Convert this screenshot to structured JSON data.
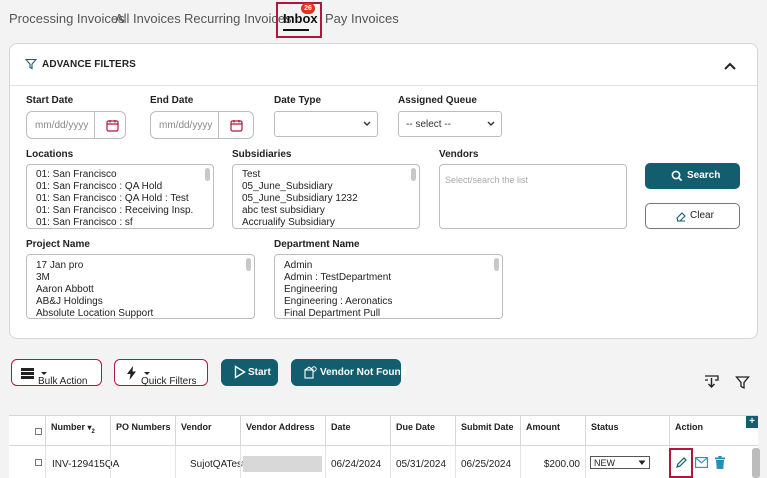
{
  "tabs": [
    {
      "label": "Processing Invoices"
    },
    {
      "label": "All Invoices"
    },
    {
      "label": "Recurring Invoices"
    },
    {
      "label": "Inbox",
      "badge": "26",
      "active": true
    },
    {
      "label": "Pay Invoices"
    }
  ],
  "filters": {
    "title": "ADVANCE FILTERS",
    "start_date": {
      "label": "Start Date",
      "placeholder": "mm/dd/yyyy"
    },
    "end_date": {
      "label": "End Date",
      "placeholder": "mm/dd/yyyy"
    },
    "date_type": {
      "label": "Date Type",
      "value": ""
    },
    "assigned_queue": {
      "label": "Assigned Queue",
      "value": "-- select --"
    },
    "locations": {
      "label": "Locations",
      "items": [
        "01: San Francisco",
        "01: San Francisco : QA Hold",
        "01: San Francisco : QA Hold : Test",
        "01: San Francisco : Receiving Insp.",
        "01: San Francisco : sf"
      ]
    },
    "subsidiaries": {
      "label": "Subsidiaries",
      "items": [
        "Test",
        "05_June_Subsidiary",
        "05_June_Subsidiary 1232",
        "abc test subsidiary",
        "Accrualify Subsidiary"
      ]
    },
    "vendors": {
      "label": "Vendors",
      "placeholder": "Select/search the list"
    },
    "project_name": {
      "label": "Project Name",
      "items": [
        "17 Jan pro",
        "3M",
        "Aaron Abbott",
        "AB&J Holdings",
        "Absolute Location Support"
      ]
    },
    "department_name": {
      "label": "Department Name",
      "items": [
        "Admin",
        "Admin : TestDepartment",
        "Engineering",
        "Engineering : Aeronatics",
        "Final Department Pull"
      ]
    },
    "search_label": "Search",
    "clear_label": "Clear"
  },
  "actions": {
    "bulk_action": "Bulk Action",
    "quick_filters": "Quick Filters",
    "start": "Start",
    "vendor_not_found": "Vendor Not Found"
  },
  "table": {
    "columns": [
      "Number",
      "PO Numbers",
      "Vendor",
      "Vendor Address",
      "Date",
      "Due Date",
      "Submit Date",
      "Amount",
      "Status",
      "Action"
    ],
    "sort_indicator": "2",
    "rows": [
      {
        "number": "INV-129415QA",
        "po_numbers": "",
        "vendor": "SujotQATest",
        "vendor_address": "",
        "date": "06/24/2024",
        "due_date": "05/31/2024",
        "submit_date": "06/25/2024",
        "amount": "$200.00",
        "status": "NEW"
      }
    ]
  },
  "colors": {
    "accent": "#125d6e",
    "highlight": "#b0173c",
    "badge": "#e0341f"
  }
}
